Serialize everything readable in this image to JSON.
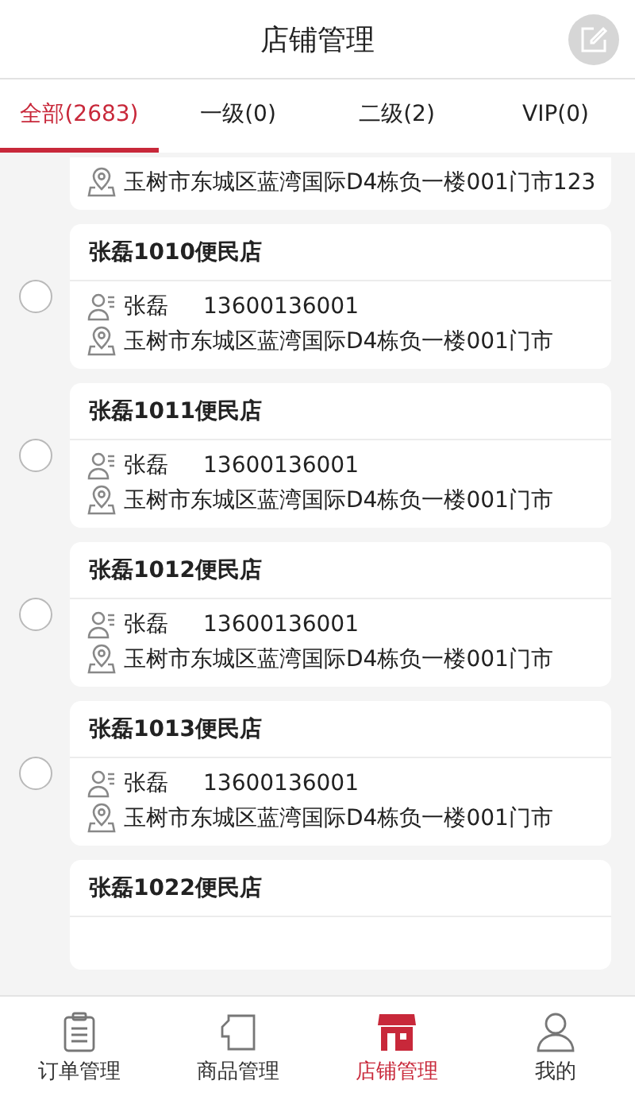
{
  "header": {
    "title": "店铺管理"
  },
  "tabs": [
    {
      "label": "全部(2683)",
      "selected": true
    },
    {
      "label": "一级(0)",
      "selected": false
    },
    {
      "label": "二级(2)",
      "selected": false
    },
    {
      "label": "VIP(0)",
      "selected": false
    }
  ],
  "stores": [
    {
      "kind": "partial",
      "address": "玉树市东城区蓝湾国际D4栋负一楼001门市123"
    },
    {
      "kind": "full",
      "name": "张磊1010便民店",
      "contact": "张磊",
      "phone": "13600136001",
      "address": "玉树市东城区蓝湾国际D4栋负一楼001门市",
      "checked": false
    },
    {
      "kind": "full",
      "name": "张磊1011便民店",
      "contact": "张磊",
      "phone": "13600136001",
      "address": "玉树市东城区蓝湾国际D4栋负一楼001门市",
      "checked": false
    },
    {
      "kind": "full",
      "name": "张磊1012便民店",
      "contact": "张磊",
      "phone": "13600136001",
      "address": "玉树市东城区蓝湾国际D4栋负一楼001门市",
      "checked": false
    },
    {
      "kind": "full",
      "name": "张磊1013便民店",
      "contact": "张磊",
      "phone": "13600136001",
      "address": "玉树市东城区蓝湾国际D4栋负一楼001门市",
      "checked": false
    },
    {
      "kind": "title",
      "name": "张磊1022便民店"
    }
  ],
  "nav": [
    {
      "kind": "orders",
      "label": "订单管理",
      "selected": false
    },
    {
      "kind": "goods",
      "label": "商品管理",
      "selected": false
    },
    {
      "kind": "store",
      "label": "店铺管理",
      "selected": true
    },
    {
      "kind": "me",
      "label": "我的",
      "selected": false
    }
  ]
}
